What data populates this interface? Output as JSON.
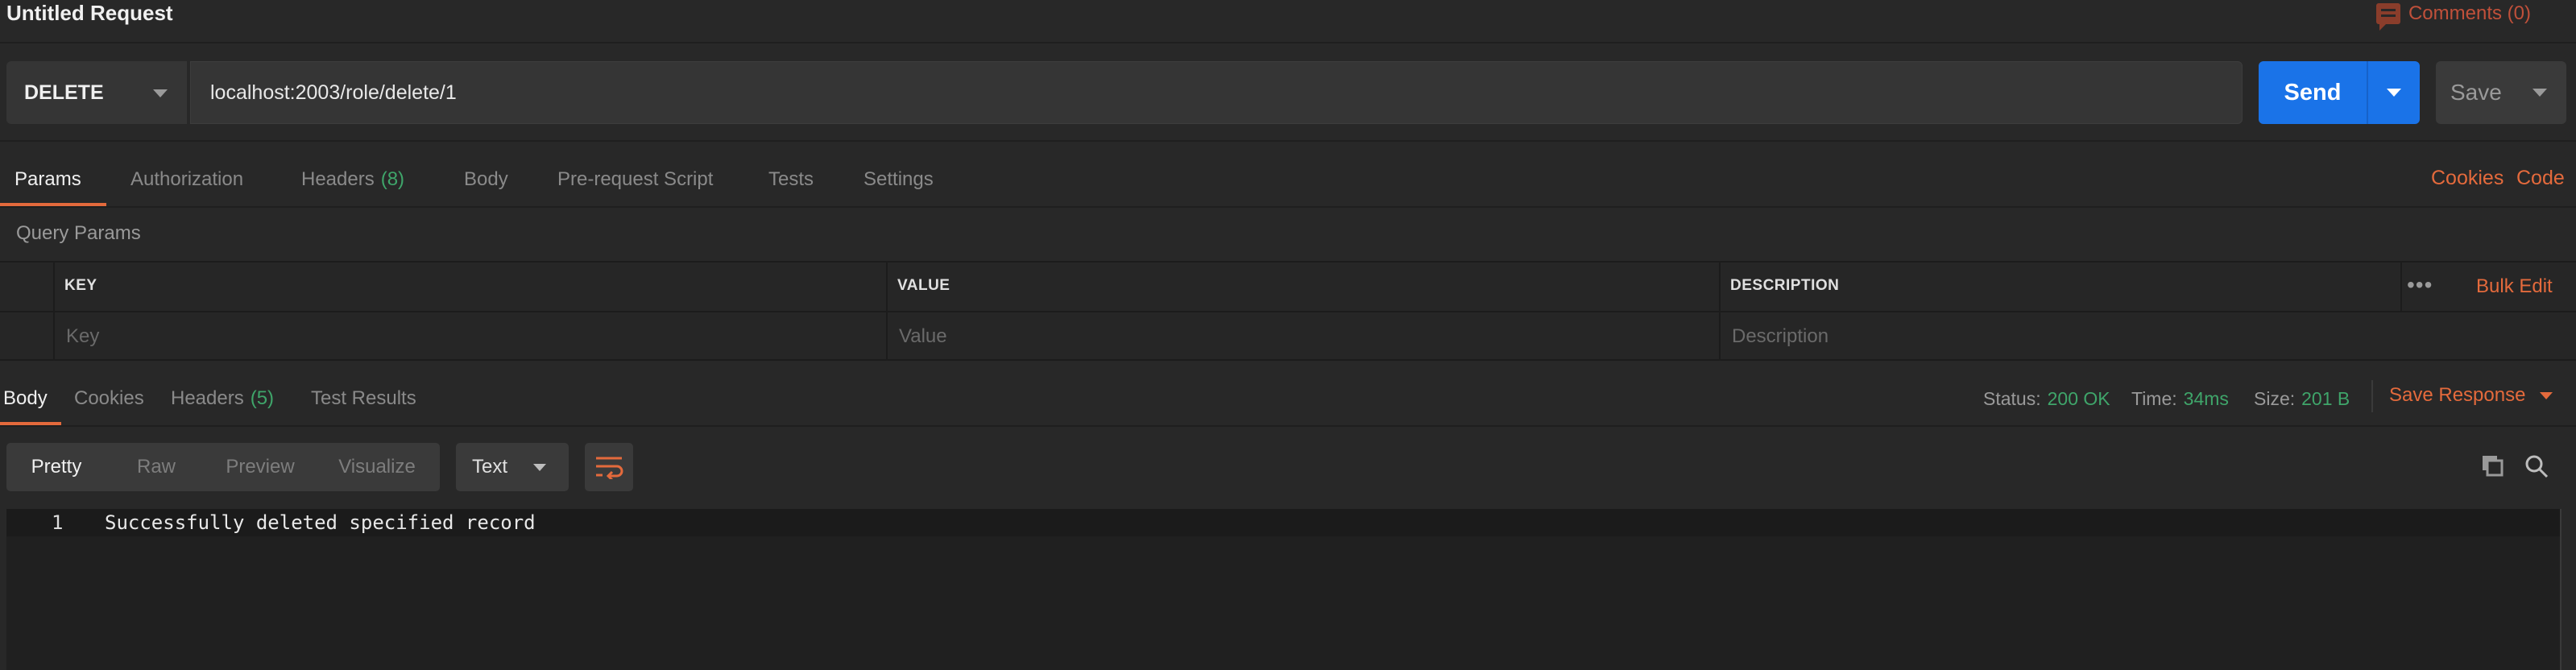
{
  "title": "Untitled Request",
  "comments_label": "Comments (0)",
  "request": {
    "method": "DELETE",
    "url": "localhost:2003/role/delete/1",
    "send_label": "Send",
    "save_label": "Save"
  },
  "request_tabs": {
    "params": "Params",
    "authorization": "Authorization",
    "headers": "Headers",
    "headers_count": "(8)",
    "body": "Body",
    "pre_request": "Pre-request Script",
    "tests": "Tests",
    "settings": "Settings",
    "active": "Params"
  },
  "links": {
    "cookies": "Cookies",
    "code": "Code"
  },
  "query_params": {
    "label": "Query Params",
    "columns": [
      "KEY",
      "VALUE",
      "DESCRIPTION"
    ],
    "placeholders": [
      "Key",
      "Value",
      "Description"
    ],
    "dots": "•••",
    "bulk_edit": "Bulk Edit"
  },
  "response_tabs": {
    "body": "Body",
    "cookies": "Cookies",
    "headers": "Headers",
    "headers_count": "(5)",
    "test_results": "Test Results",
    "active": "Body"
  },
  "response_meta": {
    "status_label": "Status:",
    "status_value": "200 OK",
    "time_label": "Time:",
    "time_value": "34ms",
    "size_label": "Size:",
    "size_value": "201 B",
    "save_response": "Save Response"
  },
  "view_modes": {
    "pretty": "Pretty",
    "raw": "Raw",
    "preview": "Preview",
    "visualize": "Visualize",
    "active": "Pretty"
  },
  "format": "Text",
  "response_body": {
    "line_number": "1",
    "text": "Successfully deleted specified record"
  },
  "colors": {
    "accent": "#e46a3c",
    "send": "#1a73e8",
    "success": "#3fa56a",
    "background": "#282828"
  },
  "icons": [
    "comment-icon",
    "caret-down-icon",
    "more-dots-icon",
    "wrap-lines-icon",
    "copy-icon",
    "search-icon"
  ]
}
